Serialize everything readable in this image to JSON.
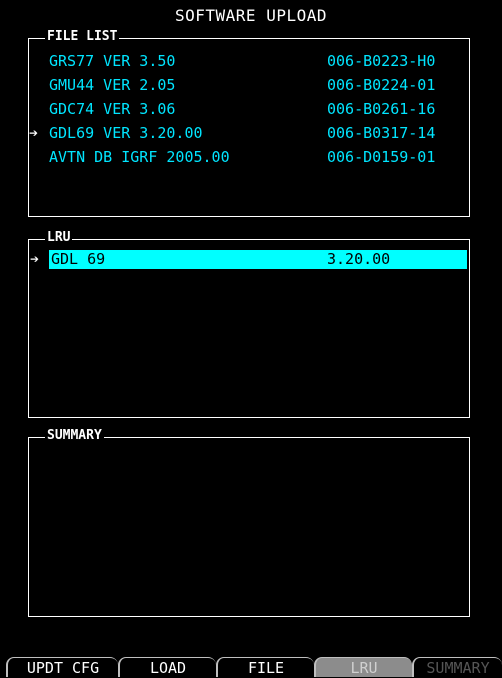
{
  "title": "SOFTWARE UPLOAD",
  "file_list": {
    "label": "FILE LIST",
    "items": [
      {
        "name": "GRS77 VER 3.50",
        "part": "006-B0223-H0",
        "selected": false
      },
      {
        "name": "GMU44 VER 2.05",
        "part": "006-B0224-01",
        "selected": false
      },
      {
        "name": "GDC74 VER 3.06",
        "part": "006-B0261-16",
        "selected": false
      },
      {
        "name": "GDL69 VER 3.20.00",
        "part": "006-B0317-14",
        "selected": true
      },
      {
        "name": "AVTN DB IGRF 2005.00",
        "part": "006-D0159-01",
        "selected": false
      }
    ]
  },
  "lru": {
    "label": "LRU",
    "selected": {
      "name": "GDL 69",
      "version": "3.20.00"
    }
  },
  "summary": {
    "label": "SUMMARY"
  },
  "arrow_glyph": "➔",
  "softkeys": [
    "UPDT CFG",
    "LOAD",
    "FILE",
    "LRU",
    "SUMMARY"
  ],
  "colors": {
    "background": "#000000",
    "text_cyan": "#00e5ff",
    "highlight": "#00ffff",
    "border": "#ffffff",
    "softkey_active": "#8c8c8c"
  }
}
